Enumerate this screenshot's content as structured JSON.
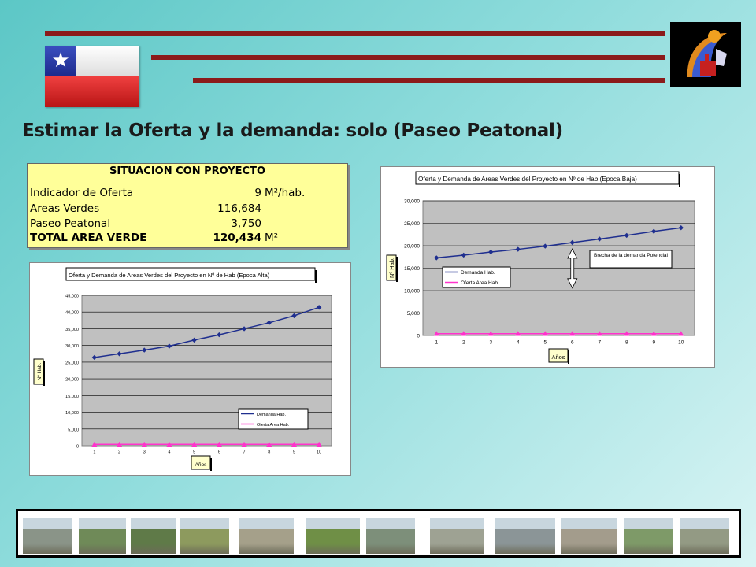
{
  "title": "Estimar la Oferta y la demanda:  solo (Paseo Peatonal)",
  "colors": {
    "bar": "#8b1b1b",
    "demand": "#1f2f8f",
    "offer": "#ff33cc",
    "plot_bg": "#c0c0c0",
    "table_bg": "#ffff99"
  },
  "icons": {
    "flag": "chile-flag-icon",
    "logo": "municipal-logo-icon"
  },
  "table": {
    "header": "SITUACION CON PROYECTO",
    "rows": [
      {
        "label": "Indicador de Oferta",
        "value": "9",
        "unit": "M²/hab."
      },
      {
        "label": "Areas Verdes",
        "value": "116,684",
        "unit": ""
      },
      {
        "label": "Paseo Peatonal",
        "value": "3,750",
        "unit": ""
      },
      {
        "label": "TOTAL AREA VERDE",
        "value": "120,434",
        "unit": "M²"
      }
    ]
  },
  "chart_data": [
    {
      "type": "line",
      "title": "Oferta y Demanda de Areas Verdes del Proyecto en Nº de Hab (Epoca Baja)",
      "xlabel": "Años",
      "ylabel": "Nº Hab.",
      "x": [
        1,
        2,
        3,
        4,
        5,
        6,
        7,
        8,
        9,
        10
      ],
      "ylim": [
        0,
        30000
      ],
      "yticks": [
        "0",
        "5,000",
        "10,000",
        "15,000",
        "20,000",
        "25,000",
        "30,000"
      ],
      "series": [
        {
          "name": "Demanda Hab.",
          "values": [
            17300,
            17900,
            18600,
            19200,
            19900,
            20700,
            21500,
            22300,
            23200,
            24000
          ]
        },
        {
          "name": "Oferta Area Hab.",
          "values": [
            400,
            400,
            400,
            400,
            400,
            400,
            400,
            400,
            400,
            400
          ]
        }
      ],
      "annotation": "Brecha de la demanda Potencial",
      "grid": true,
      "legend": "center-left"
    },
    {
      "type": "line",
      "title": "Oferta y Demanda de Areas Verdes del Proyecto en Nº de Hab (Epoca Alta)",
      "xlabel": "Años",
      "ylabel": "Nº Hab.",
      "x": [
        1,
        2,
        3,
        4,
        5,
        6,
        7,
        8,
        9,
        10
      ],
      "ylim": [
        0,
        45000
      ],
      "yticks": [
        "0",
        "5,000",
        "10,000",
        "15,000",
        "20,000",
        "25,000",
        "30,000",
        "35,000",
        "40,000",
        "45,000"
      ],
      "series": [
        {
          "name": "Demanda Hab.",
          "values": [
            26400,
            27500,
            28600,
            29800,
            31600,
            33200,
            35000,
            36800,
            38900,
            41400
          ]
        },
        {
          "name": "Oferta Area Hab.",
          "values": [
            400,
            400,
            400,
            400,
            400,
            400,
            400,
            400,
            400,
            400
          ]
        }
      ],
      "grid": true,
      "legend": "bottom-right"
    }
  ],
  "thumbnails": [
    {
      "name": "river-channel-photo",
      "color": "#8a9488"
    },
    {
      "name": "trees-photo",
      "color": "#6f8a58"
    },
    {
      "name": "vegetation-photo",
      "color": "#5f7a48"
    },
    {
      "name": "path-photo",
      "color": "#8d9a5e"
    },
    {
      "name": "dry-field-photo",
      "color": "#a5a08a"
    },
    {
      "name": "grass-field-photo",
      "color": "#6f8f46"
    },
    {
      "name": "poplar-trees-photo",
      "color": "#7d8f7a"
    },
    {
      "name": "riverbank-photo",
      "color": "#9ea293"
    },
    {
      "name": "bridge-photo",
      "color": "#8b9597"
    },
    {
      "name": "rocky-bank-photo",
      "color": "#a39c8c"
    },
    {
      "name": "willow-tree-photo",
      "color": "#7e9a68"
    },
    {
      "name": "canal-photo",
      "color": "#939a84"
    },
    {
      "name": "mountain-view-photo",
      "color": "#8fa08a"
    }
  ]
}
